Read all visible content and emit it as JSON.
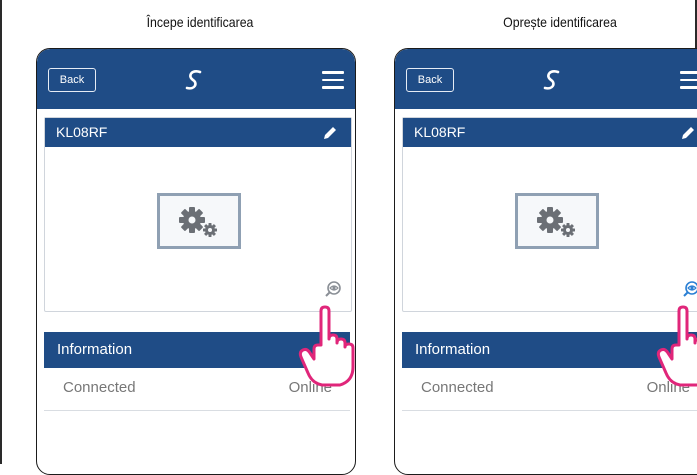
{
  "captions": {
    "left": "Începe identificarea",
    "right": "Oprește identificarea"
  },
  "panels": [
    {
      "back_label": "Back",
      "device": {
        "name": "KL08RF"
      },
      "info": {
        "title": "Information",
        "row_label": "Connected",
        "row_value": "Online"
      },
      "identify_icon_color": "#8a8f96"
    },
    {
      "back_label": "Back",
      "device": {
        "name": "KL08RF"
      },
      "info": {
        "title": "Information",
        "row_label": "Connected",
        "row_value": "Online"
      },
      "identify_icon_color": "#2a7fd4"
    }
  ],
  "colors": {
    "bar": "#1f4c86",
    "hand_stroke": "#e0267a",
    "image_border": "#8fa0b3"
  },
  "icons": [
    "back-button",
    "logo-icon",
    "menu-icon",
    "pencil-icon",
    "settings-gears-icon",
    "identify-eye-icon",
    "pointing-hand-icon"
  ]
}
